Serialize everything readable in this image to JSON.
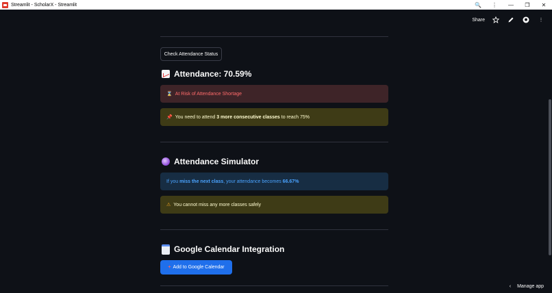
{
  "window": {
    "title": "Streamlit - ScholarX - Streamlit",
    "controls": [
      "search-icon",
      "more-icon",
      "minimize-icon",
      "restore-icon",
      "close-icon"
    ]
  },
  "header": {
    "share_label": "Share"
  },
  "buttons": {
    "check_status": "Check Attendance Status",
    "add_calendar": "Add to Google Calendar"
  },
  "attendance": {
    "heading": "Attendance: 70.59%",
    "risk_alert": "At Risk of Attendance Shortage",
    "need_prefix": "You need to attend ",
    "need_bold": "3 more consecutive classes",
    "need_suffix": " to reach 75%"
  },
  "simulator": {
    "heading": "Attendance Simulator",
    "info_prefix": "If you ",
    "info_bold1": "miss the next class",
    "info_mid": ", your attendance becomes ",
    "info_bold2": "66.67%",
    "warning": "You cannot miss any more classes safely"
  },
  "calendar": {
    "heading": "Google Calendar Integration"
  },
  "footer": {
    "manage_app": "Manage app"
  },
  "colors": {
    "background": "#0e1117",
    "error_bg": "#3e2428",
    "warning_bg": "#3e3b16",
    "info_bg": "#172d43",
    "primary": "#1f6feb"
  }
}
